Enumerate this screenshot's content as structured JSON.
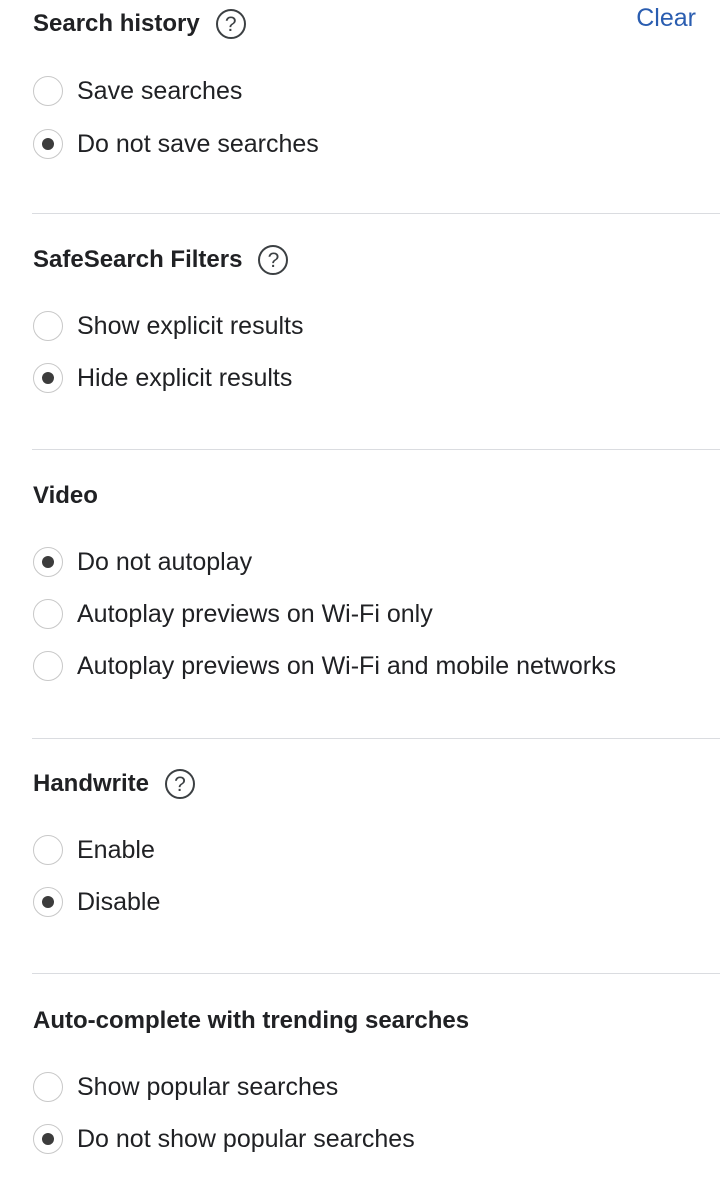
{
  "search_history": {
    "title": "Search history",
    "clear_label": "Clear",
    "options": [
      {
        "label": "Save searches",
        "checked": false
      },
      {
        "label": "Do not save searches",
        "checked": true
      }
    ]
  },
  "safesearch": {
    "title": "SafeSearch Filters",
    "options": [
      {
        "label": "Show explicit results",
        "checked": false
      },
      {
        "label": "Hide explicit results",
        "checked": true
      }
    ]
  },
  "video": {
    "title": "Video",
    "options": [
      {
        "label": "Do not autoplay",
        "checked": true
      },
      {
        "label": "Autoplay previews on Wi-Fi only",
        "checked": false
      },
      {
        "label": "Autoplay previews on Wi-Fi and mobile networks",
        "checked": false
      }
    ]
  },
  "handwrite": {
    "title": "Handwrite",
    "options": [
      {
        "label": "Enable",
        "checked": false
      },
      {
        "label": "Disable",
        "checked": true
      }
    ]
  },
  "autocomplete": {
    "title": "Auto-complete with trending searches",
    "options": [
      {
        "label": "Show popular searches",
        "checked": false
      },
      {
        "label": "Do not show popular searches",
        "checked": true
      }
    ]
  },
  "icons": {
    "help": "help-circle-icon",
    "radio": "radio-button"
  },
  "colors": {
    "link": "#2a5db0",
    "text": "#202124",
    "divider": "#dadce0",
    "radio_dot": "#3c3c3c"
  }
}
